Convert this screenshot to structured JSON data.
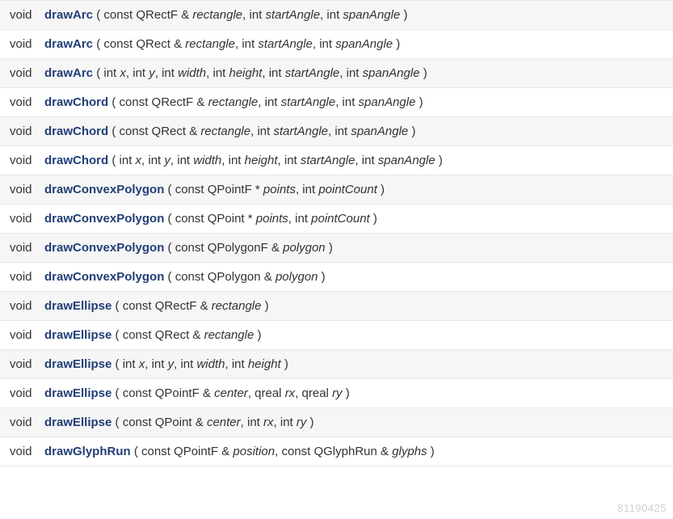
{
  "rows": [
    {
      "ret": "void",
      "fn": "drawArc",
      "params": [
        {
          "type": "const QRectF &",
          "name": "rectangle"
        },
        {
          "type": "int",
          "name": "startAngle"
        },
        {
          "type": "int",
          "name": "spanAngle"
        }
      ]
    },
    {
      "ret": "void",
      "fn": "drawArc",
      "params": [
        {
          "type": "const QRect &",
          "name": "rectangle"
        },
        {
          "type": "int",
          "name": "startAngle"
        },
        {
          "type": "int",
          "name": "spanAngle"
        }
      ]
    },
    {
      "ret": "void",
      "fn": "drawArc",
      "params": [
        {
          "type": "int",
          "name": "x"
        },
        {
          "type": "int",
          "name": "y"
        },
        {
          "type": "int",
          "name": "width"
        },
        {
          "type": "int",
          "name": "height"
        },
        {
          "type": "int",
          "name": "startAngle"
        },
        {
          "type": "int",
          "name": "spanAngle"
        }
      ]
    },
    {
      "ret": "void",
      "fn": "drawChord",
      "params": [
        {
          "type": "const QRectF &",
          "name": "rectangle"
        },
        {
          "type": "int",
          "name": "startAngle"
        },
        {
          "type": "int",
          "name": "spanAngle"
        }
      ]
    },
    {
      "ret": "void",
      "fn": "drawChord",
      "params": [
        {
          "type": "const QRect &",
          "name": "rectangle"
        },
        {
          "type": "int",
          "name": "startAngle"
        },
        {
          "type": "int",
          "name": "spanAngle"
        }
      ]
    },
    {
      "ret": "void",
      "fn": "drawChord",
      "params": [
        {
          "type": "int",
          "name": "x"
        },
        {
          "type": "int",
          "name": "y"
        },
        {
          "type": "int",
          "name": "width"
        },
        {
          "type": "int",
          "name": "height"
        },
        {
          "type": "int",
          "name": "startAngle"
        },
        {
          "type": "int",
          "name": "spanAngle"
        }
      ]
    },
    {
      "ret": "void",
      "fn": "drawConvexPolygon",
      "params": [
        {
          "type": "const QPointF *",
          "name": "points"
        },
        {
          "type": "int",
          "name": "pointCount"
        }
      ]
    },
    {
      "ret": "void",
      "fn": "drawConvexPolygon",
      "params": [
        {
          "type": "const QPoint *",
          "name": "points"
        },
        {
          "type": "int",
          "name": "pointCount"
        }
      ]
    },
    {
      "ret": "void",
      "fn": "drawConvexPolygon",
      "params": [
        {
          "type": "const QPolygonF &",
          "name": "polygon"
        }
      ]
    },
    {
      "ret": "void",
      "fn": "drawConvexPolygon",
      "params": [
        {
          "type": "const QPolygon &",
          "name": "polygon"
        }
      ]
    },
    {
      "ret": "void",
      "fn": "drawEllipse",
      "params": [
        {
          "type": "const QRectF &",
          "name": "rectangle"
        }
      ]
    },
    {
      "ret": "void",
      "fn": "drawEllipse",
      "params": [
        {
          "type": "const QRect &",
          "name": "rectangle"
        }
      ]
    },
    {
      "ret": "void",
      "fn": "drawEllipse",
      "params": [
        {
          "type": "int",
          "name": "x"
        },
        {
          "type": "int",
          "name": "y"
        },
        {
          "type": "int",
          "name": "width"
        },
        {
          "type": "int",
          "name": "height"
        }
      ]
    },
    {
      "ret": "void",
      "fn": "drawEllipse",
      "params": [
        {
          "type": "const QPointF &",
          "name": "center"
        },
        {
          "type": "qreal",
          "name": "rx"
        },
        {
          "type": "qreal",
          "name": "ry"
        }
      ]
    },
    {
      "ret": "void",
      "fn": "drawEllipse",
      "params": [
        {
          "type": "const QPoint &",
          "name": "center"
        },
        {
          "type": "int",
          "name": "rx"
        },
        {
          "type": "int",
          "name": "ry"
        }
      ]
    },
    {
      "ret": "void",
      "fn": "drawGlyphRun",
      "params": [
        {
          "type": "const QPointF &",
          "name": "position"
        },
        {
          "type": "const QGlyphRun &",
          "name": "glyphs"
        }
      ]
    }
  ],
  "watermark": "81190425"
}
